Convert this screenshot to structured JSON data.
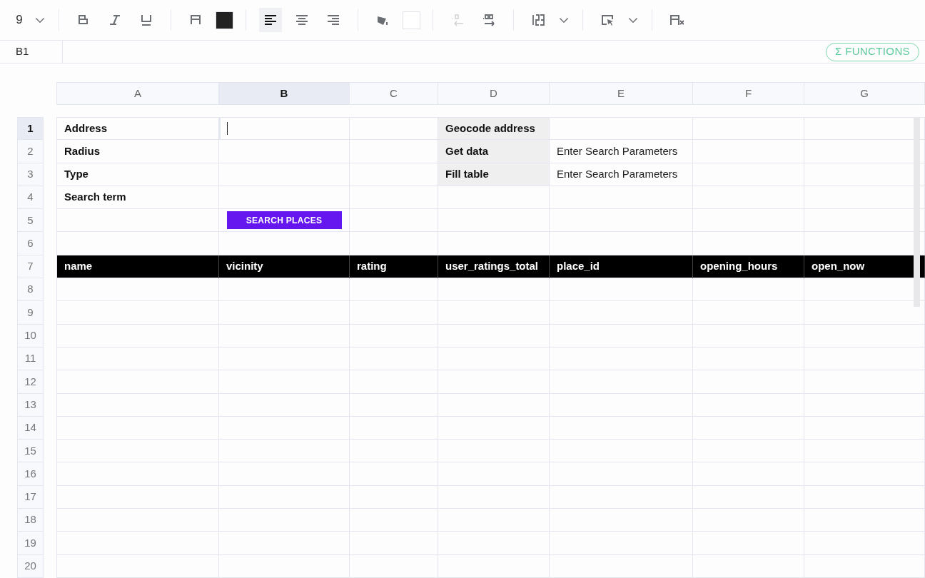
{
  "toolbar": {
    "groups": [
      {
        "items": [
          {
            "kind": "font_size",
            "text": "9",
            "selected": false,
            "disabled": false
          },
          {
            "kind": "chevron",
            "selected": false,
            "disabled": false
          }
        ]
      },
      {
        "items": [
          {
            "kind": "bold",
            "selected": false,
            "disabled": false
          },
          {
            "kind": "italic",
            "selected": false,
            "disabled": false
          },
          {
            "kind": "underline",
            "selected": false,
            "disabled": false
          }
        ]
      },
      {
        "items": [
          {
            "kind": "text_color",
            "selected": false,
            "disabled": false
          },
          {
            "kind": "swatch",
            "color": "#222222",
            "selected": false,
            "disabled": false
          }
        ]
      },
      {
        "items": [
          {
            "kind": "align_left",
            "selected": true,
            "disabled": false
          },
          {
            "kind": "align_center",
            "selected": false,
            "disabled": false
          },
          {
            "kind": "align_right",
            "selected": false,
            "disabled": false
          }
        ]
      },
      {
        "items": [
          {
            "kind": "fill",
            "selected": false,
            "disabled": false
          },
          {
            "kind": "swatch",
            "color": "#ffffff",
            "selected": false,
            "disabled": false
          }
        ]
      },
      {
        "items": [
          {
            "kind": "decimal_decrease",
            "selected": false,
            "disabled": true
          },
          {
            "kind": "decimal_increase",
            "selected": false,
            "disabled": false
          }
        ]
      },
      {
        "items": [
          {
            "kind": "number_format",
            "selected": false,
            "disabled": false
          },
          {
            "kind": "chevron",
            "selected": false,
            "disabled": false
          }
        ]
      },
      {
        "items": [
          {
            "kind": "borders",
            "selected": false,
            "disabled": false
          },
          {
            "kind": "chevron",
            "selected": false,
            "disabled": false
          }
        ]
      },
      {
        "items": [
          {
            "kind": "clear_format",
            "selected": false,
            "disabled": false
          }
        ]
      }
    ]
  },
  "formula_bar": {
    "cell_ref": "B1",
    "functions_button": "Σ FUNCTIONS"
  },
  "columns": [
    {
      "label": "A",
      "selected": false
    },
    {
      "label": "B",
      "selected": true
    },
    {
      "label": "C",
      "selected": false
    },
    {
      "label": "D",
      "selected": false
    },
    {
      "label": "E",
      "selected": false
    },
    {
      "label": "F",
      "selected": false
    },
    {
      "label": "G",
      "selected": false
    }
  ],
  "rows": [
    {
      "number": "1",
      "selected": true,
      "cells": [
        {
          "kind": "label",
          "text": "Address"
        },
        {
          "kind": "editing"
        },
        {
          "kind": "empty"
        },
        {
          "kind": "action",
          "text": "Geocode address"
        },
        {
          "kind": "empty"
        },
        {
          "kind": "empty"
        },
        {
          "kind": "empty"
        }
      ]
    },
    {
      "number": "2",
      "selected": false,
      "cells": [
        {
          "kind": "label",
          "text": "Radius"
        },
        {
          "kind": "empty"
        },
        {
          "kind": "empty"
        },
        {
          "kind": "action",
          "text": "Get data"
        },
        {
          "kind": "text",
          "text": "Enter Search Parameters"
        },
        {
          "kind": "empty"
        },
        {
          "kind": "empty"
        }
      ]
    },
    {
      "number": "3",
      "selected": false,
      "cells": [
        {
          "kind": "label",
          "text": "Type"
        },
        {
          "kind": "empty"
        },
        {
          "kind": "empty"
        },
        {
          "kind": "action",
          "text": "Fill table"
        },
        {
          "kind": "text",
          "text": "Enter Search Parameters"
        },
        {
          "kind": "empty"
        },
        {
          "kind": "empty"
        }
      ]
    },
    {
      "number": "4",
      "selected": false,
      "cells": [
        {
          "kind": "label",
          "text": "Search term"
        },
        {
          "kind": "empty"
        },
        {
          "kind": "empty"
        },
        {
          "kind": "empty"
        },
        {
          "kind": "empty"
        },
        {
          "kind": "empty"
        },
        {
          "kind": "empty"
        }
      ]
    },
    {
      "number": "5",
      "selected": false,
      "cells": [
        {
          "kind": "empty"
        },
        {
          "kind": "button",
          "text": "SEARCH PLACES"
        },
        {
          "kind": "empty"
        },
        {
          "kind": "empty"
        },
        {
          "kind": "empty"
        },
        {
          "kind": "empty"
        },
        {
          "kind": "empty"
        }
      ]
    },
    {
      "number": "6",
      "selected": false,
      "cells": [
        {
          "kind": "empty"
        },
        {
          "kind": "empty"
        },
        {
          "kind": "empty"
        },
        {
          "kind": "empty"
        },
        {
          "kind": "empty"
        },
        {
          "kind": "empty"
        },
        {
          "kind": "empty"
        }
      ]
    },
    {
      "number": "7",
      "selected": false,
      "cells": [
        {
          "kind": "header",
          "text": "name"
        },
        {
          "kind": "header",
          "text": "vicinity"
        },
        {
          "kind": "header",
          "text": "rating"
        },
        {
          "kind": "header",
          "text": "user_ratings_total"
        },
        {
          "kind": "header",
          "text": "place_id"
        },
        {
          "kind": "header",
          "text": "opening_hours"
        },
        {
          "kind": "header",
          "text": "open_now"
        }
      ]
    },
    {
      "number": "8",
      "selected": false,
      "cells": []
    },
    {
      "number": "9",
      "selected": false,
      "cells": []
    },
    {
      "number": "10",
      "selected": false,
      "cells": []
    },
    {
      "number": "11",
      "selected": false,
      "cells": []
    },
    {
      "number": "12",
      "selected": false,
      "cells": []
    },
    {
      "number": "13",
      "selected": false,
      "cells": []
    },
    {
      "number": "14",
      "selected": false,
      "cells": []
    },
    {
      "number": "15",
      "selected": false,
      "cells": []
    },
    {
      "number": "16",
      "selected": false,
      "cells": []
    },
    {
      "number": "17",
      "selected": false,
      "cells": []
    },
    {
      "number": "18",
      "selected": false,
      "cells": []
    },
    {
      "number": "19",
      "selected": false,
      "cells": []
    },
    {
      "number": "20",
      "selected": false,
      "cells": []
    }
  ]
}
